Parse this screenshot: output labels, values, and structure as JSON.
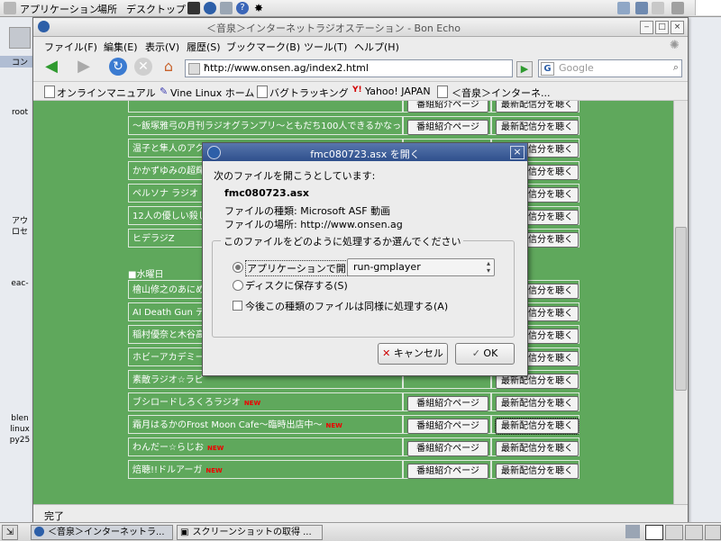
{
  "panel": {
    "applications": "アプリケーション",
    "places": "場所",
    "desktop": "デスクトップ"
  },
  "desktop_icons": [
    "コン",
    "root",
    "アウ",
    "ロセ",
    "eac-",
    "blen",
    "linux",
    "py25"
  ],
  "window": {
    "title": "＜音泉＞インターネットラジオステーション - Bon Echo",
    "menus": [
      "ファイル(F)",
      "編集(E)",
      "表示(V)",
      "履歴(S)",
      "ブックマーク(B)",
      "ツール(T)",
      "ヘルプ(H)"
    ],
    "url": "http://www.onsen.ag/index2.html",
    "search_placeholder": "Google",
    "bookmarks": [
      "オンラインマニュアル",
      "Vine Linux ホーム",
      "バグトラッキング",
      "Yahoo! JAPAN",
      "＜音泉＞インターネ..."
    ],
    "status": "完了"
  },
  "page": {
    "btn_intro": "番組紹介ページ",
    "btn_listen": "最新配信分を聴く",
    "day_header": "■水曜日",
    "new_badge": "NEW",
    "rows_a": [
      "〜飯塚雅弓の月刊ラジオグランプリ〜ともだち100人できるかなっ♪",
      "温子と隼人のアク",
      "かかずゆみの超輝",
      "ペルソナ ラジオ",
      "12人の優しい殺し",
      "ヒデラジZ"
    ],
    "rows_b": [
      "檜山修之のあにめ",
      "AI Death Gun デス",
      "稲村優奈と木谷高",
      "ホビーアカデミー",
      "素敵ラジオ☆ラピ",
      "ブシロードしろくろラジオ",
      "霜月はるかのFrost Moon Cafe〜臨時出店中〜",
      "わんだー☆らじお",
      "焙聴!!ドルアーガ"
    ]
  },
  "dialog": {
    "title": "fmc080723.asx を開く",
    "heading": "次のファイルを開こうとしています:",
    "filename": "fmc080723.asx",
    "filetype": "ファイルの種類: Microsoft ASF 動画",
    "location": "ファイルの場所: http://www.onsen.ag",
    "frame_label": "このファイルをどのように処理するか選んでください",
    "open_with_label": "アプリケーションで開く(O):",
    "open_with_value": "run-gmplayer",
    "save_label": "ディスクに保存する(S)",
    "remember_label": "今後この種類のファイルは同様に処理する(A)",
    "cancel_label": "キャンセル",
    "ok_label": "OK"
  },
  "taskbar": {
    "items": [
      "＜音泉＞インターネットラ...",
      "スクリーンショットの取得 ..."
    ]
  },
  "colors": {
    "page_bg": "#5fa85c",
    "dialog_title": "#3a5a96",
    "new_badge": "#ee0000"
  }
}
